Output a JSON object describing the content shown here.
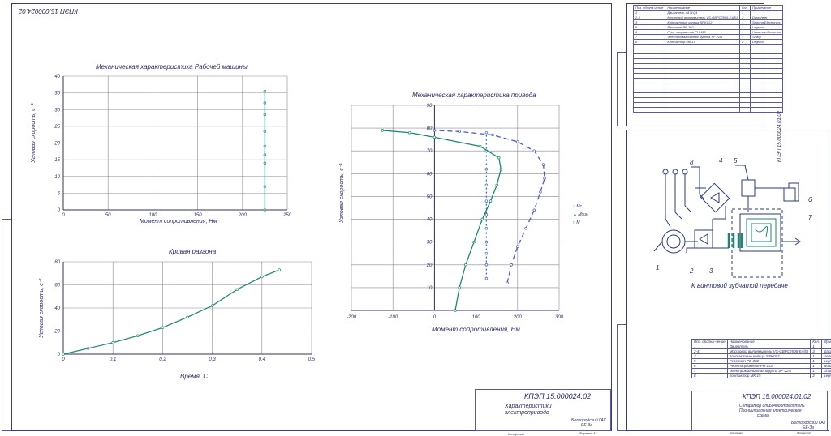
{
  "sheet1": {
    "stamp_code": "КПЭП 15.000024.02",
    "corner_code": "КПЭП 15.000024.02",
    "stamp_title_line1": "Характеристики",
    "stamp_title_line2": "электропривода",
    "stamp_org_line1": "Белгородский ГАУ",
    "stamp_org_line2": "ЕЕ-3а",
    "stamp_copy": "Копировал",
    "stamp_format": "Формат  А1"
  },
  "sheet2": {
    "stamp_code": "КПЭП 15.000024.01.02",
    "corner_code": "КПЭП 15.000024.01.02",
    "stamp_title_line1": "Сепаратор cлиБочноотделитель",
    "stamp_title_line2": "Принципиальная электрическая",
    "stamp_title_line3": "схема",
    "stamp_org_line1": "Белгородский ГАУ",
    "stamp_org_line2": "ЕЕ-3а",
    "stamp_copy": "Копировал",
    "stamp_format": "Формат  А3",
    "diagram_caption": "К винтовой зубчатой передаче",
    "callouts": [
      "1",
      "2",
      "3",
      "4",
      "5",
      "6",
      "7",
      "8"
    ],
    "spec_headers": [
      "Поз. обозна-чение",
      "Наименование",
      "Кол.",
      "Примечание"
    ],
    "spec_rows": [
      [
        "1",
        "Двигатель",
        "1",
        ""
      ],
      [
        "2-4",
        "Мостовой выпрямитель VS-GBPC2506-E4/51",
        "3",
        "Datasheet"
      ],
      [
        "3",
        "Контактные кольца SRK012",
        "1",
        "Senring Electronics"
      ],
      [
        "5",
        "Реостат РБ-302",
        "1",
        "Legrand"
      ],
      [
        "6",
        "Реле напряжения РН-113",
        "1",
        "Новатек-Электро"
      ],
      [
        "7",
        "Электромагнитная муфта SF-22N",
        "1",
        "Sharp"
      ],
      [
        "8",
        "Контактор МК-15",
        "2",
        "Legrand"
      ]
    ]
  },
  "spec_sheet": {
    "headers": [
      "Поз. обозна-чение",
      "Наименование",
      "Кол.",
      "Примечание"
    ],
    "rows": [
      [
        "1",
        "Двигатель 4А71Q4",
        "1",
        ""
      ],
      [
        "2-4",
        "Мостовой выпрямитель VS-GBPC2506-E4/51",
        "2",
        "Datasheet"
      ],
      [
        "3",
        "Контактные кольца SRK012",
        "1",
        "Senring Electronics"
      ],
      [
        "5",
        "Реостат РБ-302",
        "1",
        "Legrand"
      ],
      [
        "6",
        "Реле напряжения РН-113",
        "1",
        "Новатек-Электро"
      ],
      [
        "7",
        "Электромагнитная муфта SF-22N",
        "1",
        "Sharp"
      ],
      [
        "8",
        "Контактор МК-15",
        "2",
        "Legrand"
      ]
    ]
  },
  "chart_data": [
    {
      "type": "scatter",
      "title": "Механическая характеристика Рабочей машины",
      "xlabel": "Момент сопротивления, Нм",
      "ylabel": "Угловая скорость, с⁻¹",
      "xlim": [
        0,
        250
      ],
      "ylim": [
        0,
        40
      ],
      "xticks": [
        0,
        50,
        100,
        150,
        200,
        250
      ],
      "yticks": [
        0,
        5,
        10,
        15,
        20,
        25,
        30,
        35,
        40
      ],
      "grid": true,
      "series": [
        {
          "x": [
            225,
            225,
            225,
            225,
            225,
            225,
            225,
            225,
            225
          ],
          "y": [
            0,
            7,
            14,
            16.5,
            19,
            23.5,
            28.5,
            32,
            35.5
          ],
          "color": "#2a8a78"
        }
      ]
    },
    {
      "type": "line",
      "title": "Кривая разгона",
      "xlabel": "Время, С",
      "ylabel": "Угловая скорость, с⁻¹",
      "xlim": [
        0,
        0.5
      ],
      "ylim": [
        0,
        80
      ],
      "xticks": [
        0,
        0.1,
        0.2,
        0.3,
        0.4,
        0.5
      ],
      "yticks": [
        0,
        20,
        40,
        60,
        80
      ],
      "grid": true,
      "series": [
        {
          "x": [
            0,
            0.05,
            0.1,
            0.15,
            0.2,
            0.25,
            0.3,
            0.35,
            0.4,
            0.435
          ],
          "y": [
            0,
            5,
            10,
            16,
            23,
            32,
            42,
            56,
            67,
            73
          ],
          "color": "#2a8a78"
        }
      ]
    },
    {
      "type": "line",
      "title": "Механическая характеристика привода",
      "xlabel": "Момент сопротивления, Нм",
      "ylabel": "Угловая скорость, с⁻¹",
      "xlim": [
        -200,
        300
      ],
      "ylim": [
        0,
        90
      ],
      "xticks": [
        -200,
        -100,
        0,
        100,
        200,
        300
      ],
      "yticks": [
        0,
        10,
        20,
        30,
        40,
        50,
        60,
        70,
        80,
        90
      ],
      "grid": true,
      "legend_position": "right",
      "series": [
        {
          "name": "Мс",
          "color": "#3a6acc",
          "dash": "2,3",
          "x": [
            125,
            125,
            125,
            125,
            125,
            125,
            125,
            125,
            125,
            125,
            125
          ],
          "y": [
            14,
            20,
            25,
            30,
            36,
            42,
            48,
            55,
            62,
            70,
            78
          ]
        },
        {
          "name": "Мдин",
          "color": "#1a8a6a",
          "dash": "",
          "x": [
            50,
            60,
            75,
            95,
            115,
            135,
            150,
            160,
            155,
            110,
            0,
            -60,
            -125
          ],
          "y": [
            0,
            10,
            20,
            30,
            40,
            48,
            55,
            62,
            67,
            72,
            76,
            78,
            79
          ]
        },
        {
          "name": "М",
          "color": "#4a5acc",
          "dash": "6,4",
          "x": [
            175,
            185,
            200,
            220,
            240,
            255,
            265,
            262,
            240,
            200,
            140,
            60,
            0
          ],
          "y": [
            12,
            20,
            28,
            36,
            44,
            52,
            58,
            64,
            70,
            74,
            77,
            78.5,
            79
          ]
        }
      ]
    }
  ],
  "colors": {
    "ink": "#2a2a6a",
    "curve": "#2a8a78",
    "grid": "#777788",
    "blue": "#3a5acc"
  }
}
